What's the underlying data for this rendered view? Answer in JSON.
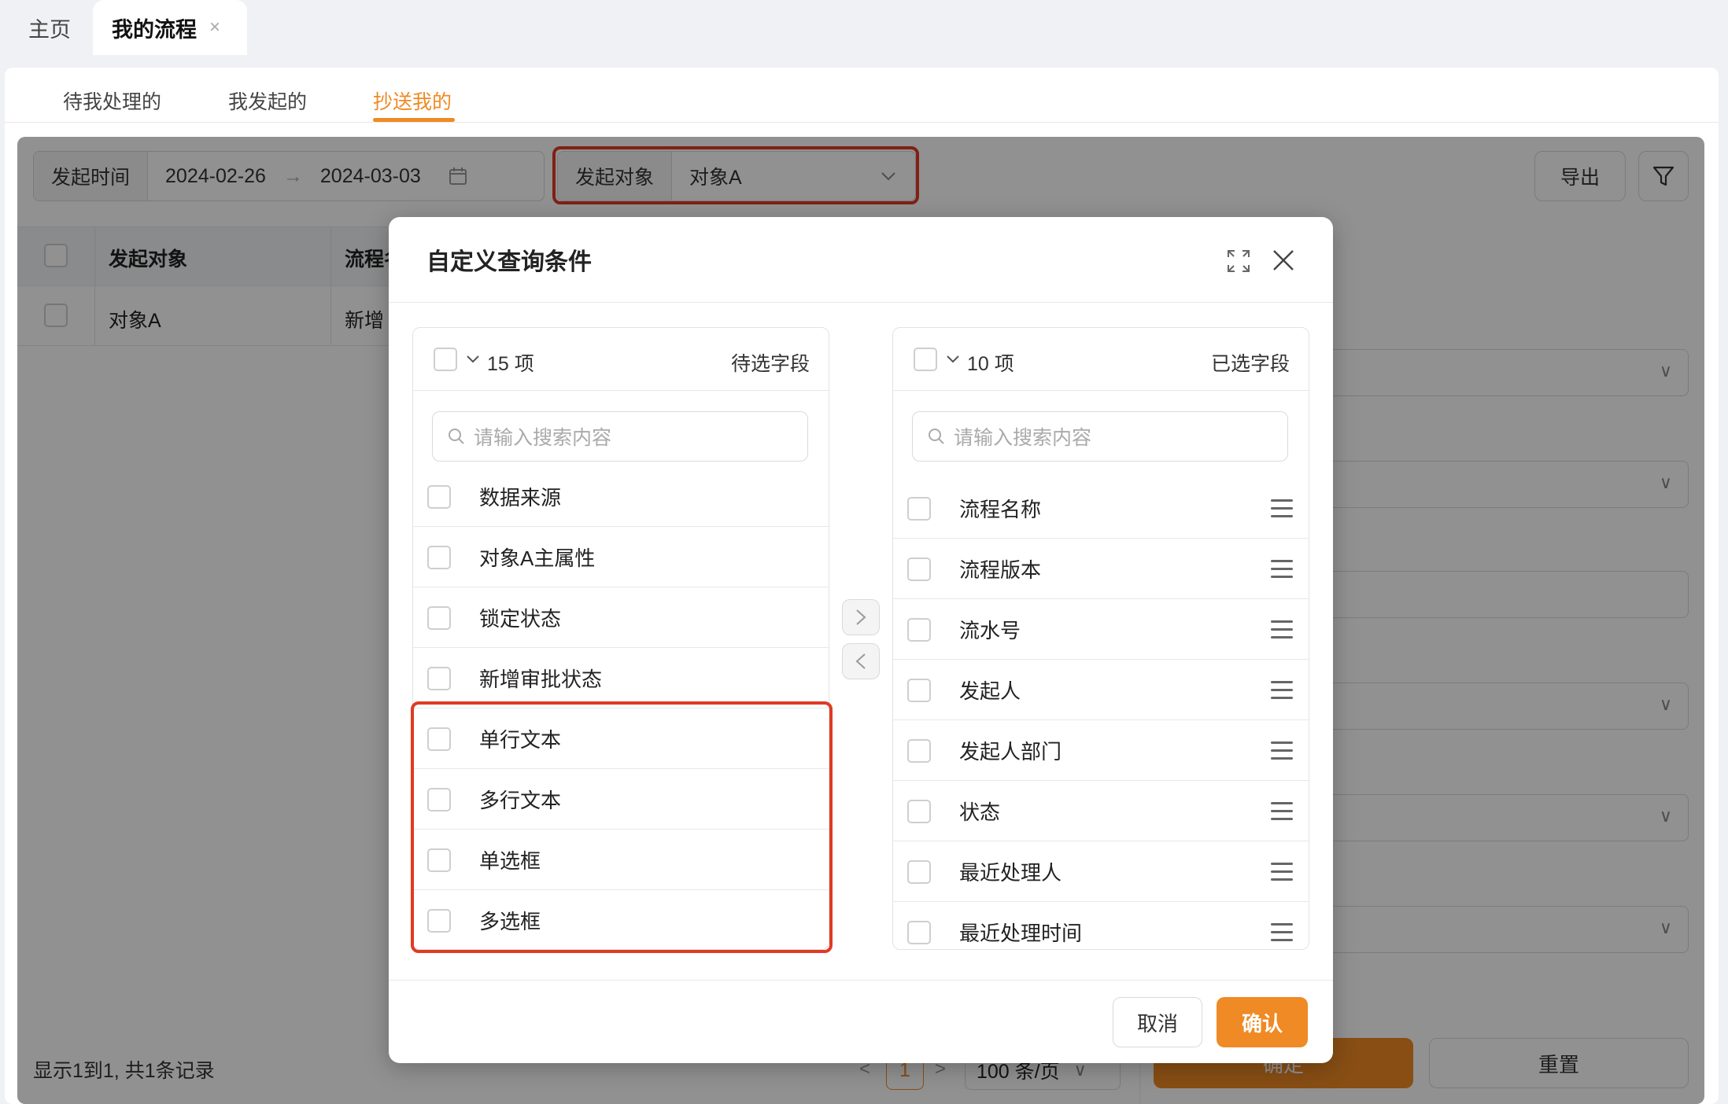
{
  "tabs": {
    "home": "主页",
    "active": "我的流程",
    "close": "×"
  },
  "subtabs": [
    "待我处理的",
    "我发起的",
    "抄送我的"
  ],
  "filters": {
    "time_label": "发起时间",
    "date_start": "2024-02-26",
    "date_arrow": "→",
    "date_end": "2024-03-03",
    "object_label": "发起对象",
    "object_value": "对象A",
    "export": "导出"
  },
  "table": {
    "headers": [
      "发起对象",
      "流程名称"
    ],
    "rows": [
      [
        "对象A",
        "新增"
      ]
    ]
  },
  "footer": {
    "info": "显示1到1, 共1条记录",
    "page": "1",
    "page_size": "100 条/页",
    "confirm": "确定",
    "reset": "重置"
  },
  "modal": {
    "title": "自定义查询条件",
    "left": {
      "count": "15 项",
      "title": "待选字段",
      "placeholder": "请输入搜索内容",
      "items": [
        "数据来源",
        "对象A主属性",
        "锁定状态",
        "新增审批状态",
        "单行文本",
        "多行文本",
        "单选框",
        "多选框"
      ]
    },
    "right": {
      "count": "10 项",
      "title": "已选字段",
      "placeholder": "请输入搜索内容",
      "items": [
        "流程名称",
        "流程版本",
        "流水号",
        "发起人",
        "发起人部门",
        "状态",
        "最近处理人",
        "最近处理时间"
      ]
    },
    "cancel": "取消",
    "confirm": "确认"
  },
  "colors": {
    "accent": "#ef8a24",
    "highlight": "#e03a24"
  }
}
